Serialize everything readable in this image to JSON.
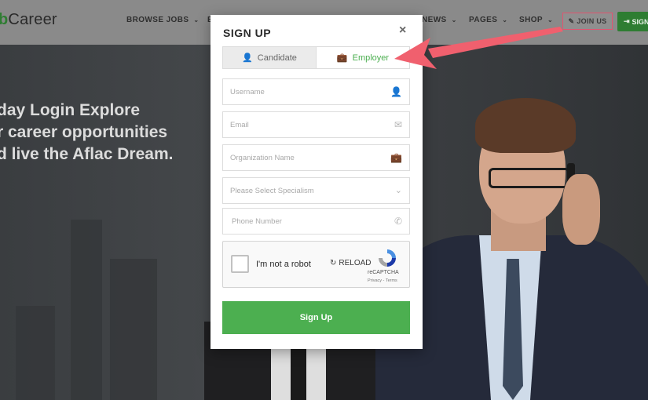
{
  "brand": {
    "logo_prefix": "b",
    "logo_text": "Career"
  },
  "nav": {
    "items": [
      {
        "label": "BROWSE JOBS"
      },
      {
        "label": "NEWS"
      },
      {
        "label": "PAGES"
      },
      {
        "label": "SHOP"
      }
    ],
    "join_us": "JOIN US",
    "sign_in": "SIGN"
  },
  "hero": {
    "line1": "day Login Explore",
    "line2": "r career opportunities",
    "line3": "d live the Aflac Dream."
  },
  "modal": {
    "title": "SIGN UP",
    "close": "×",
    "tabs": {
      "candidate": "Candidate",
      "employer": "Employer"
    },
    "fields": {
      "username": "Username",
      "email": "Email",
      "organization": "Organization Name",
      "specialism": "Please Select Specialism",
      "phone": "Phone Number"
    },
    "captcha": {
      "label": "I'm not a robot",
      "reload": "RELOAD",
      "brand": "reCAPTCHA",
      "links": "Privacy - Terms"
    },
    "submit": "Sign Up"
  },
  "colors": {
    "accent": "#4caf50",
    "highlight": "#e05570",
    "arrow": "#f0606e"
  },
  "icons": {
    "candidate_tab": "user-plus-icon",
    "employer_tab": "briefcase-icon",
    "username": "user-icon",
    "email": "envelope-icon",
    "organization": "briefcase-icon",
    "specialism": "chevron-down-icon",
    "phone": "phone-icon"
  }
}
